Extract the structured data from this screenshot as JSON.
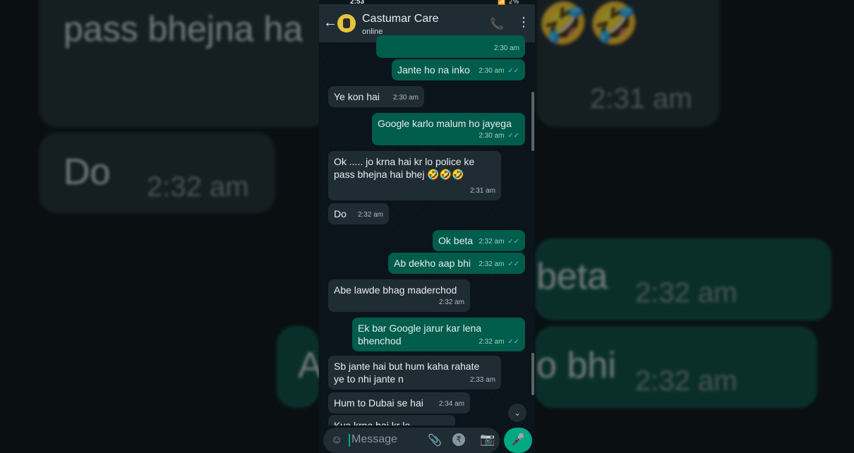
{
  "status_bar": {
    "clock": "2:53",
    "icons": "📶 2%"
  },
  "header": {
    "back": "←",
    "contact_name": "Castumar Care",
    "contact_status": "online",
    "call": "📞",
    "menu": "⋮"
  },
  "messages": [
    {
      "dir": "out",
      "text": "",
      "time": "2:30 am"
    },
    {
      "dir": "out",
      "text": "Jante ho na inko",
      "time": "2:30 am"
    },
    {
      "dir": "in",
      "text": "Ye kon hai",
      "time": "2:30 am"
    },
    {
      "dir": "out",
      "text": "Google karlo malum ho jayega",
      "time": "2:30 am"
    },
    {
      "dir": "in",
      "text": "Ok ..... jo krna hai kr lo police ke pass bhejna hai bhej 🤣🤣🤣",
      "time": "2:31 am"
    },
    {
      "dir": "in",
      "text": "Do",
      "time": "2:32 am"
    },
    {
      "dir": "out",
      "text": "Ok beta",
      "time": "2:32 am"
    },
    {
      "dir": "out",
      "text": "Ab dekho aap bhi",
      "time": "2:32 am"
    },
    {
      "dir": "in",
      "text": "Abe lawde bhag maderchod",
      "time": "2:32 am"
    },
    {
      "dir": "out",
      "text": "Ek bar Google jarur kar lena bhenchod",
      "time": "2:32 am"
    },
    {
      "dir": "in",
      "text": "Sb jante hai but hum kaha rahate ye to nhi jante n",
      "time": "2:33 am"
    },
    {
      "dir": "in",
      "text": "Hum to Dubai se hai",
      "time": "2:34 am"
    },
    {
      "dir": "in",
      "text": "Kya krna hai kr lo",
      "time": ""
    }
  ],
  "read_ticks": "✓✓",
  "input": {
    "placeholder": "Message",
    "emoji_icon": "☺",
    "attach_icon": "📎",
    "rupee_icon": "₹",
    "camera_icon": "📷",
    "mic_icon": "🎤",
    "scroll_down_icon": "⌄"
  },
  "background_zoom": {
    "line1": "pass bhejna ha",
    "emoji": "🤣🤣",
    "time1": "2:31 am",
    "do": "Do",
    "time2": "2:32 am",
    "beta": "beta",
    "time3": "2:32 am",
    "a": "A",
    "bhi": "o bhi",
    "time4": "2:32 am"
  }
}
